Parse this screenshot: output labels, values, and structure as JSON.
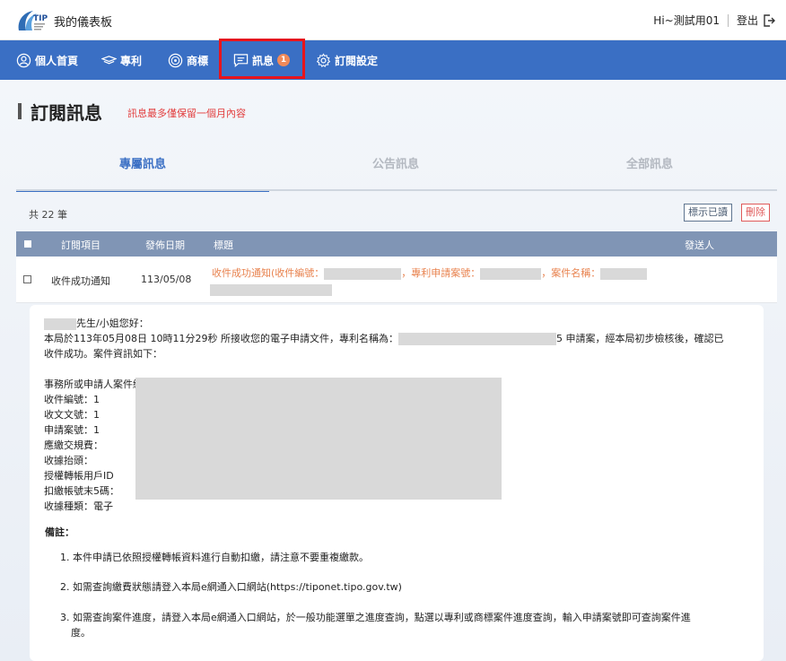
{
  "header": {
    "title": "我的儀表板",
    "greeting": "Hi~測試用01",
    "logout_label": "登出"
  },
  "nav": {
    "items": [
      {
        "label": "個人首頁",
        "icon": "user-icon"
      },
      {
        "label": "專利",
        "icon": "patent-icon"
      },
      {
        "label": "商標",
        "icon": "trademark-icon"
      },
      {
        "label": "訊息",
        "icon": "message-icon",
        "badge": "1"
      },
      {
        "label": "訂閱設定",
        "icon": "gear-icon"
      }
    ]
  },
  "page": {
    "title": "訂閱訊息",
    "note": "訊息最多僅保留一個月內容"
  },
  "tabs": [
    {
      "label": "專屬訊息",
      "active": true
    },
    {
      "label": "公告訊息",
      "active": false
    },
    {
      "label": "全部訊息",
      "active": false
    }
  ],
  "list": {
    "count": "共 22 筆",
    "mark_read_label": "標示已讀",
    "delete_label": "刪除",
    "columns": [
      "訂閱項目",
      "發佈日期",
      "標題",
      "發送人"
    ],
    "rows": [
      {
        "item": "收件成功通知",
        "date": "113/05/08",
        "title_part1": "收件成功通知(收件編號：",
        "title_part2": "，專利申請案號：",
        "title_part3": "，案件名稱："
      }
    ]
  },
  "detail": {
    "salutation": "先生/小姐您好：",
    "body_line1_a": "本局於113年05月08日 10時11分29秒 所接收您的電子申請文件，專利名稱為：",
    "body_line1_b": "5 申請案，經本局初步檢核後，確認已",
    "body_line2": "收件成功。案件資訊如下：",
    "fields": [
      "事務所或申請人案件編號",
      "收件編號：1",
      "收文文號：1",
      "申請案號：1",
      "應繳交規費：",
      "收據抬頭：",
      "授權轉帳用戶ID",
      "扣繳帳號末5碼：",
      "收據種類：電子"
    ],
    "remark_title": "備註：",
    "remarks": [
      "1. 本件申請已依照授權轉帳資料進行自動扣繳，請注意不要重複繳款。",
      "2. 如需查詢繳費狀態請登入本局e網通入口網站(https://tiponet.tipo.gov.tw)",
      "3. 如需查詢案件進度，請登入本局e網通入口網站，於一般功能選單之進度查詢，點選以專利或商標案件進度查詢，輸入申請案號即可查詢案件進",
      "度。"
    ]
  },
  "colors": {
    "nav_bg": "#3a6fc4",
    "accent": "#3a6fc4",
    "warning": "#e23c3c",
    "title_orange": "#e8824e",
    "badge": "#f08a5a",
    "table_head": "#8095b5"
  }
}
